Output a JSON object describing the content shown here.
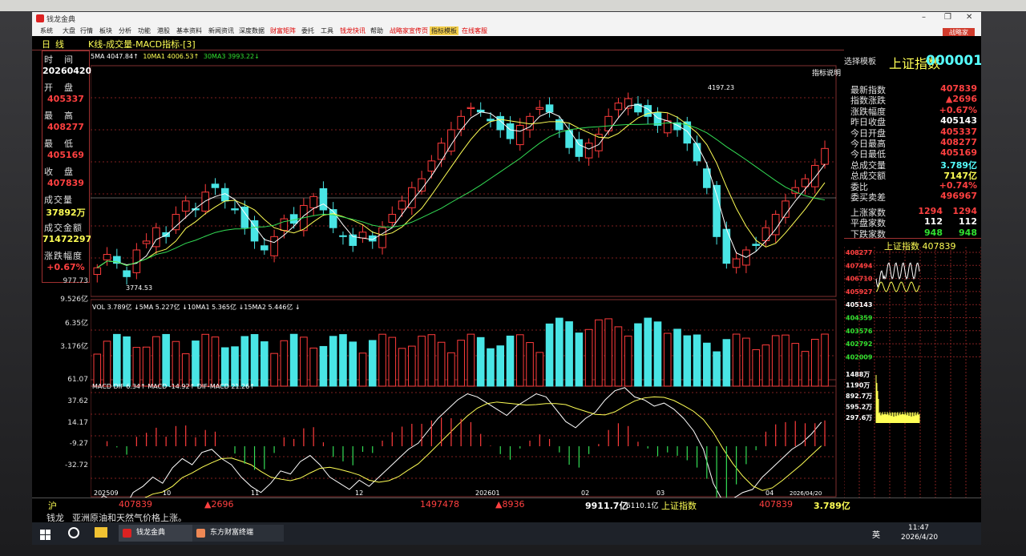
{
  "window": {
    "app_title": "钱龙金典",
    "brand_button": "战略家"
  },
  "menu": [
    "系统",
    "大盘",
    "行情",
    "板块",
    "分析",
    "功能",
    "港股",
    "基本资料",
    "新闻资讯",
    "深度数据",
    "财富矩阵",
    "委托",
    "工具",
    "钱龙快讯",
    "帮助",
    "战略家宣传页",
    "指标模板",
    "在线客服"
  ],
  "chart_tab": {
    "period": "日线",
    "title": "K线-成交量-MACD指标-[3]",
    "select_template": "选择模板",
    "indicator_note": "指标说明"
  },
  "info_panel": [
    {
      "label": "时间",
      "value": "20260420",
      "color": "white"
    },
    {
      "label": "开盘",
      "value": "405337",
      "color": "red"
    },
    {
      "label": "最高",
      "value": "408277",
      "color": "red"
    },
    {
      "label": "最低",
      "value": "405169",
      "color": "red"
    },
    {
      "label": "收盘",
      "value": "407839",
      "color": "red"
    },
    {
      "label": "成交量",
      "value": "37892万",
      "color": "yellow"
    },
    {
      "label": "成交金额",
      "value": "71472297",
      "color": "yellow"
    },
    {
      "label": "涨跌幅度",
      "value": "+0.67%",
      "color": "red"
    }
  ],
  "ma_line": {
    "ma5": "5MA 4047.84↑",
    "ma10": "10MA1 4006.53↑",
    "ma30": "30MA3 3993.22↓"
  },
  "price_annotations": {
    "high": "4197.23",
    "low": "3774.53"
  },
  "vol": {
    "header": "VOL 3.789亿 ↓5MA 5.227亿 ↓10MA1 5.365亿 ↓15MA2 5.446亿 ↓",
    "axis": [
      "9.526亿",
      "6.35亿",
      "3.176亿"
    ],
    "top": "977.73"
  },
  "macd": {
    "header": "MACD DIF 6.34↑ MACD -14.92↑ DIF-MACD 21.26↑",
    "axis": [
      "61.07",
      "37.62",
      "14.17",
      "-9.27",
      "-32.72"
    ]
  },
  "x_axis": [
    "202509",
    "10",
    "11",
    "12",
    "202601",
    "02",
    "03",
    "04"
  ],
  "date_box": "2026/04/20",
  "quote": {
    "index_name": "上证指数",
    "code": "000001",
    "rows": [
      {
        "k": "最新指数",
        "v": "407839",
        "c": "red"
      },
      {
        "k": "指数涨跌",
        "v": "▲2696",
        "c": "red"
      },
      {
        "k": "涨跌幅度",
        "v": "+0.67%",
        "c": "red"
      },
      {
        "k": "昨日收盘",
        "v": "405143",
        "c": "white"
      },
      {
        "k": "今日开盘",
        "v": "405337",
        "c": "red"
      },
      {
        "k": "今日最高",
        "v": "408277",
        "c": "red"
      },
      {
        "k": "今日最低",
        "v": "405169",
        "c": "red"
      },
      {
        "k": "总成交量",
        "v": "3.789亿",
        "c": "cyan"
      },
      {
        "k": "总成交额",
        "v": "7147亿",
        "c": "yellow"
      },
      {
        "k": "委比",
        "v": "+0.74%",
        "c": "red"
      },
      {
        "k": "委买卖差",
        "v": "496967",
        "c": "red"
      }
    ],
    "breadth": [
      {
        "k": "上涨家数",
        "a": "1294",
        "b": "1294",
        "c": "red"
      },
      {
        "k": "平盘家数",
        "a": "112",
        "b": "112",
        "c": "white"
      },
      {
        "k": "下跌家数",
        "a": "948",
        "b": "948",
        "c": "green"
      }
    ],
    "mini_title": "上证指数 407839",
    "mini_axis": [
      "408277",
      "407494",
      "406710",
      "405927",
      "405143",
      "404359",
      "403576",
      "402792",
      "402009"
    ],
    "mini_vol": [
      "1488万",
      "1190万",
      "892.7万",
      "595.2万",
      "297.6万"
    ]
  },
  "bottom": {
    "market": "沪",
    "index": "407839",
    "chg": "▲2696",
    "vol": "1497478",
    "chg2": "▲8936",
    "amount": "9911.7亿",
    "amount2": "6110.1亿",
    "name": "上证指数",
    "price": "407839",
    "vol2": "3.789亿"
  },
  "news": {
    "source": "钱龙",
    "text": "亚洲原油和天然气价格上涨。"
  },
  "taskbar": {
    "app1": "钱龙金典",
    "app2": "东方财富终端",
    "lang": "英",
    "time": "11:47",
    "date": "2026/4/20"
  },
  "colors": {
    "up": "#ff3b3b",
    "down": "#49e5e5",
    "ma5": "#ffffff",
    "ma10": "#ffff55",
    "ma30": "#33dd55",
    "grid": "#802020"
  },
  "chart_data": {
    "type": "candlestick",
    "note_series": "daily index, Sep 2025 – Apr 2026",
    "close": [
      3810,
      3840,
      3820,
      3790,
      3850,
      3870,
      3900,
      3880,
      3930,
      3960,
      3940,
      3980,
      3990,
      3960,
      3940,
      3900,
      3870,
      3850,
      3880,
      3920,
      3910,
      3950,
      3970,
      3940,
      3900,
      3880,
      3860,
      3890,
      3870,
      3900,
      3930,
      3960,
      3990,
      4010,
      4050,
      4090,
      4120,
      4150,
      4170,
      4160,
      4140,
      4120,
      4100,
      4130,
      4150,
      4170,
      4160,
      4120,
      4080,
      4060,
      4090,
      4110,
      4150,
      4180,
      4190,
      4160,
      4150,
      4130,
      4140,
      4120,
      4090,
      4050,
      3990,
      3880,
      3820,
      3830,
      3850,
      3860,
      3900,
      3930,
      3960,
      3990,
      4010,
      4040,
      4078
    ]
  }
}
